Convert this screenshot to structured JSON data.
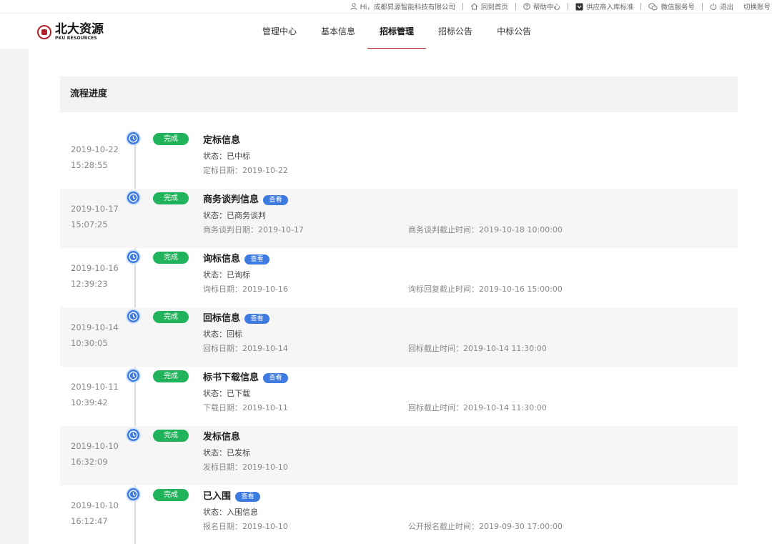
{
  "topbar": {
    "greeting": "Hi，成都昇源智能科技有限公司",
    "home": "回到首页",
    "help": "帮助中心",
    "supplier_standard": "供应商入库标准",
    "wechat": "微信服务号",
    "logout": "退出",
    "switch_account": "切换账号"
  },
  "logo": {
    "cn": "北大资源",
    "en": "PKU RESOURCES"
  },
  "nav": {
    "items": [
      "管理中心",
      "基本信息",
      "招标管理",
      "招标公告",
      "中标公告"
    ],
    "active_index": 2
  },
  "section": {
    "title": "流程进度"
  },
  "colors": {
    "brand": "#b0212b",
    "done_badge": "#21b35c",
    "accent_blue": "#3d7be0"
  },
  "timeline": [
    {
      "date": "2019-10-22",
      "time": "15:28:55",
      "badge": "完成",
      "title": "定标信息",
      "view": "",
      "status": "状态：已中标",
      "date_line": "定标日期：2019-10-22",
      "deadline": ""
    },
    {
      "date": "2019-10-17",
      "time": "15:07:25",
      "badge": "完成",
      "title": "商务谈判信息",
      "view": "查看",
      "status": "状态：已商务谈判",
      "date_line": "商务谈判日期：2019-10-17",
      "deadline": "商务谈判截止时间：2019-10-18 10:00:00"
    },
    {
      "date": "2019-10-16",
      "time": "12:39:23",
      "badge": "完成",
      "title": "询标信息",
      "view": "查看",
      "status": "状态：已询标",
      "date_line": "询标日期：2019-10-16",
      "deadline": "询标回复截止时间：2019-10-16 15:00:00"
    },
    {
      "date": "2019-10-14",
      "time": "10:30:05",
      "badge": "完成",
      "title": "回标信息",
      "view": "查看",
      "status": "状态：回标",
      "date_line": "回标日期：2019-10-14",
      "deadline": "回标截止时间：2019-10-14 11:30:00"
    },
    {
      "date": "2019-10-11",
      "time": "10:39:42",
      "badge": "完成",
      "title": "标书下载信息",
      "view": "查看",
      "status": "状态：已下载",
      "date_line": "下载日期：2019-10-11",
      "deadline": "回标截止时间：2019-10-14 11:30:00"
    },
    {
      "date": "2019-10-10",
      "time": "16:32:09",
      "badge": "完成",
      "title": "发标信息",
      "view": "",
      "status": "状态：已发标",
      "date_line": "发标日期：2019-10-10",
      "deadline": ""
    },
    {
      "date": "2019-10-10",
      "time": "16:12:47",
      "badge": "完成",
      "title": "已入围",
      "view": "查看",
      "status": "状态：入围信息",
      "date_line": "报名日期：2019-10-10",
      "deadline": "公开报名截止时间：2019-09-30 17:00:00"
    }
  ]
}
